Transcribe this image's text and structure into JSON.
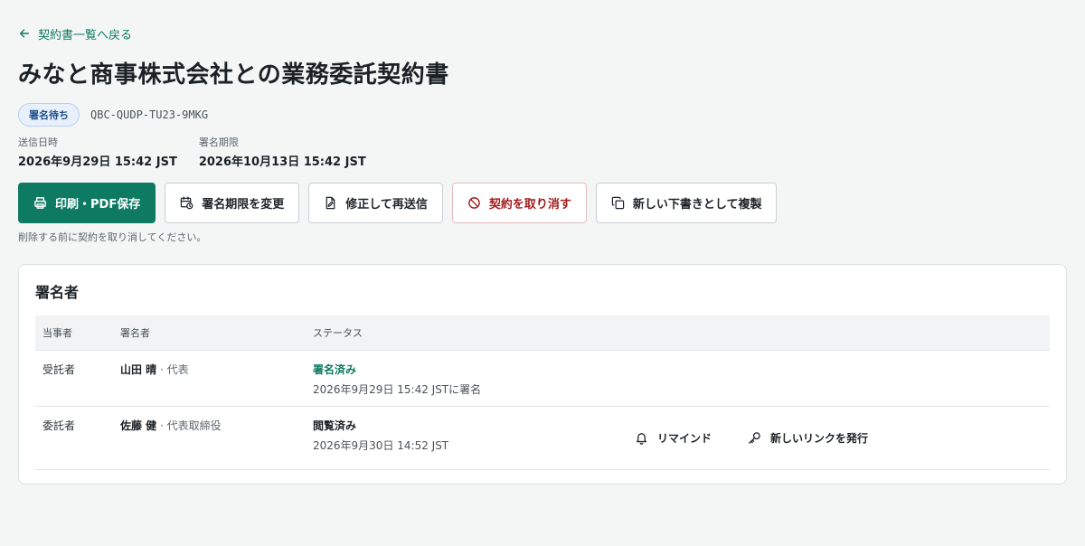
{
  "nav": {
    "back_label": "契約書一覧へ戻る"
  },
  "contract": {
    "title": "みなと商事株式会社との業務委託契約書",
    "status_badge": "署名待ち",
    "id": "QBC-QUDP-TU23-9MKG",
    "sent_label": "送信日時",
    "sent_value": "2026年9月29日 15:42 JST",
    "deadline_label": "署名期限",
    "deadline_value": "2026年10月13日 15:42 JST"
  },
  "actions": {
    "print_label": "印刷・PDF保存",
    "change_deadline_label": "署名期限を変更",
    "edit_resend_label": "修正して再送信",
    "cancel_label": "契約を取り消す",
    "duplicate_label": "新しい下書きとして複製",
    "helper_text": "削除する前に契約を取り消してください。"
  },
  "signers_card": {
    "title": "署名者",
    "columns": [
      "当事者",
      "署名者",
      "ステータス"
    ],
    "rows": [
      {
        "party": "受託者",
        "name": "山田 晴",
        "role": " · 代表",
        "status": "署名済み",
        "status_detail": "2026年9月29日 15:42 JSTに署名"
      },
      {
        "party": "委託者",
        "name": "佐藤 健",
        "role": " · 代表取締役",
        "status": "閲覧済み",
        "status_detail": "2026年9月30日 14:52 JST",
        "remind_label": "リマインド",
        "new_link_label": "新しいリンクを発行"
      }
    ]
  },
  "colors": {
    "accent": "#0f7a62",
    "badge_bg": "#e7f0fb",
    "badge_text": "#1e4f8c",
    "danger": "#a11d1d",
    "page_bg": "#f4f6f6"
  },
  "icons": {
    "back": "arrow-left-icon",
    "print": "printer-icon",
    "change_deadline": "calendar-clock-icon",
    "edit_resend": "file-edit-icon",
    "cancel": "ban-icon",
    "duplicate": "copy-icon",
    "remind": "bell-icon",
    "new_link": "key-icon"
  }
}
